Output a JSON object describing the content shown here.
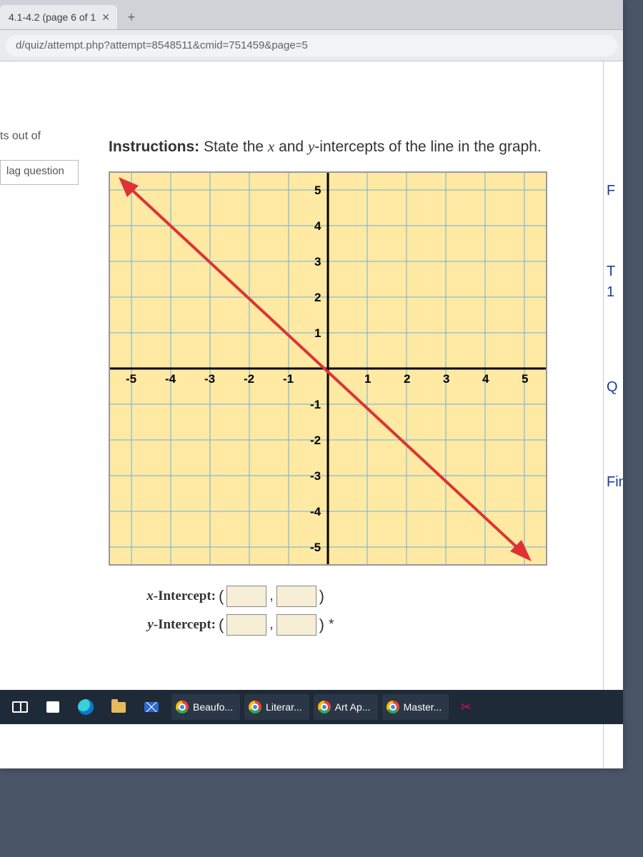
{
  "browser": {
    "tab_title": "4.1-4.2 (page 6 of 1",
    "url": "d/quiz/attempt.php?attempt=8548511&cmid=751459&page=5"
  },
  "sidebar": {
    "points_fragment": "ts out of",
    "flag_label": "lag question"
  },
  "question": {
    "instr_bold": "Instructions:",
    "instr_part1": " State the ",
    "var_x": "x",
    "instr_part2": " and ",
    "var_y": "y",
    "instr_part3": "-intercepts of the line in the graph."
  },
  "chart_data": {
    "type": "line",
    "title": "",
    "xlabel": "",
    "ylabel": "",
    "xlim": [
      -5,
      5
    ],
    "ylim": [
      -5,
      5
    ],
    "x_ticks": [
      -5,
      -4,
      -3,
      -2,
      -1,
      1,
      2,
      3,
      4,
      5
    ],
    "y_ticks": [
      5,
      4,
      3,
      2,
      1,
      -1,
      -2,
      -3,
      -4,
      -5
    ],
    "series": [
      {
        "name": "line",
        "points": [
          [
            -5,
            4.5
          ],
          [
            5,
            -5.5
          ]
        ],
        "x_intercept": [
          -0.5,
          0
        ],
        "y_intercept": [
          0,
          -0.5
        ]
      }
    ]
  },
  "answers": {
    "x_label_var": "x",
    "x_label_rest": "-Intercept:",
    "y_label_var": "y",
    "y_label_rest": "-Intercept:",
    "open": "(",
    "comma": ",",
    "close": ")",
    "star": "*"
  },
  "right_panel": {
    "f": "F",
    "t": "T",
    "one": "1",
    "q": "Q",
    "fin": "Fin"
  },
  "taskbar": {
    "items": [
      {
        "label": "Beaufo..."
      },
      {
        "label": "Literar..."
      },
      {
        "label": "Art Ap..."
      },
      {
        "label": "Master..."
      }
    ]
  }
}
